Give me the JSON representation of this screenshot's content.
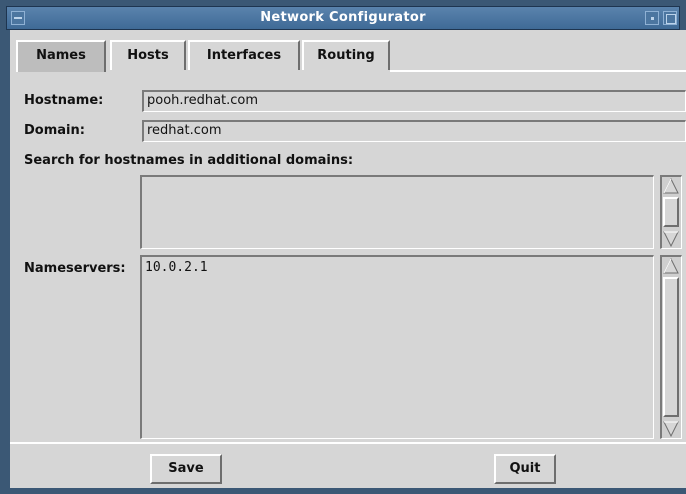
{
  "window": {
    "title": "Network Configurator"
  },
  "tabs": [
    {
      "label": "Names",
      "active": true
    },
    {
      "label": "Hosts",
      "active": false
    },
    {
      "label": "Interfaces",
      "active": false
    },
    {
      "label": "Routing",
      "active": false
    }
  ],
  "names": {
    "hostname_label": "Hostname:",
    "hostname_value": "pooh.redhat.com",
    "domain_label": "Domain:",
    "domain_value": "redhat.com",
    "search_label": "Search for hostnames in additional domains:",
    "search_domains": "",
    "nameservers_label": "Nameservers:",
    "nameservers_value": "10.0.2.1"
  },
  "buttons": {
    "save": "Save",
    "quit": "Quit"
  },
  "colors": {
    "titlebar": "#4f78a3",
    "panel": "#d6d6d6",
    "active_tab": "#bdbdbd"
  }
}
